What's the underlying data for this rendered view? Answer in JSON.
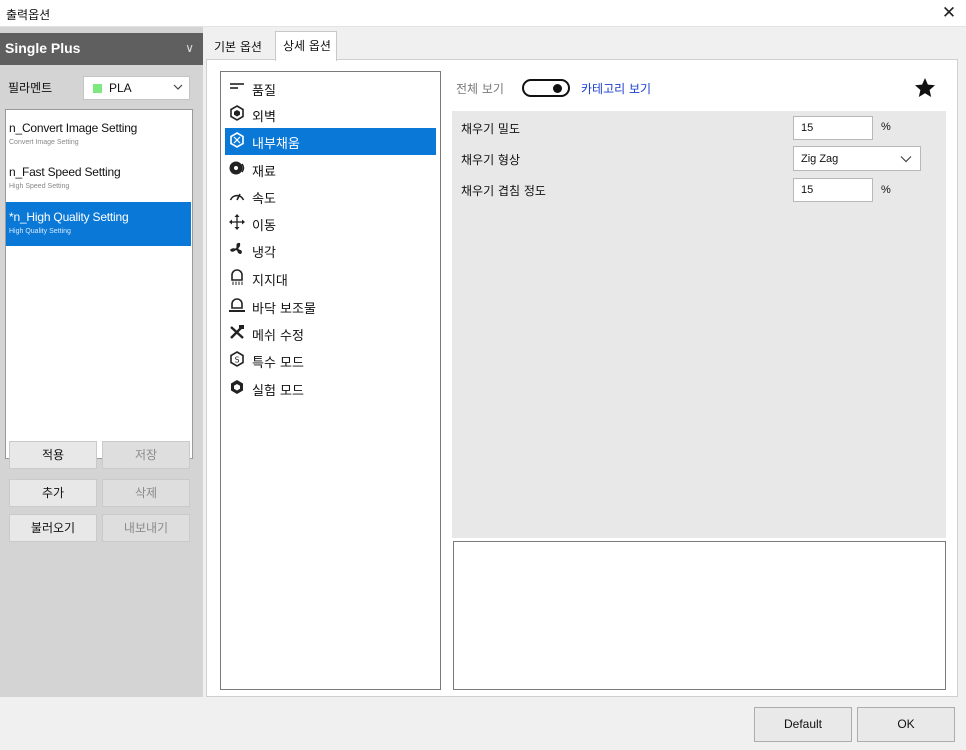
{
  "window": {
    "title": "출력옵션",
    "close_icon": "close-icon"
  },
  "machine": {
    "name": "Single Plus"
  },
  "filament": {
    "label": "필라멘트",
    "value": "PLA",
    "color": "#7de87d"
  },
  "profiles": [
    {
      "name": "n_Convert Image Setting",
      "subtitle": "Convert Image Setting",
      "selected": false
    },
    {
      "name": "n_Fast Speed Setting",
      "subtitle": "High Speed Setting",
      "selected": false
    },
    {
      "name": "*n_High Quality Setting",
      "subtitle": "High Quality Setting",
      "selected": true
    }
  ],
  "profile_buttons": {
    "apply": "적용",
    "save": "저장",
    "add": "추가",
    "delete": "삭제",
    "import": "불러오기",
    "export": "내보내기"
  },
  "tabs": {
    "basic": "기본 옵션",
    "advanced": "상세 옵션"
  },
  "categories": [
    {
      "label": "품질",
      "icon": "quality-lines-icon"
    },
    {
      "label": "외벽",
      "icon": "wall-hexagon-icon"
    },
    {
      "label": "내부채움",
      "icon": "infill-hexagon-icon"
    },
    {
      "label": "재료",
      "icon": "material-spool-icon"
    },
    {
      "label": "속도",
      "icon": "speed-gauge-icon"
    },
    {
      "label": "이동",
      "icon": "move-arrows-icon"
    },
    {
      "label": "냉각",
      "icon": "cooling-fan-icon"
    },
    {
      "label": "지지대",
      "icon": "support-icon"
    },
    {
      "label": "바닥 보조물",
      "icon": "bed-adhesion-icon"
    },
    {
      "label": "메쉬 수정",
      "icon": "mesh-tools-icon"
    },
    {
      "label": "특수 모드",
      "icon": "special-mode-icon"
    },
    {
      "label": "실험 모드",
      "icon": "experimental-mode-icon"
    }
  ],
  "view": {
    "all_label": "전체 보기",
    "category_label": "카테고리 보기",
    "star_icon": "favorite-star-icon"
  },
  "settings": {
    "infill_density": {
      "label": "채우기 밀도",
      "value": "15",
      "unit": "%"
    },
    "infill_pattern": {
      "label": "채우기 형상",
      "value": "Zig Zag"
    },
    "infill_overlap": {
      "label": "채우기 겹침 정도",
      "value": "15",
      "unit": "%"
    }
  },
  "dialog_buttons": {
    "default": "Default",
    "ok": "OK"
  },
  "colors": {
    "selection": "#0a78d7",
    "link": "#1a3fd0",
    "machine_bar": "#5f5f5f"
  }
}
